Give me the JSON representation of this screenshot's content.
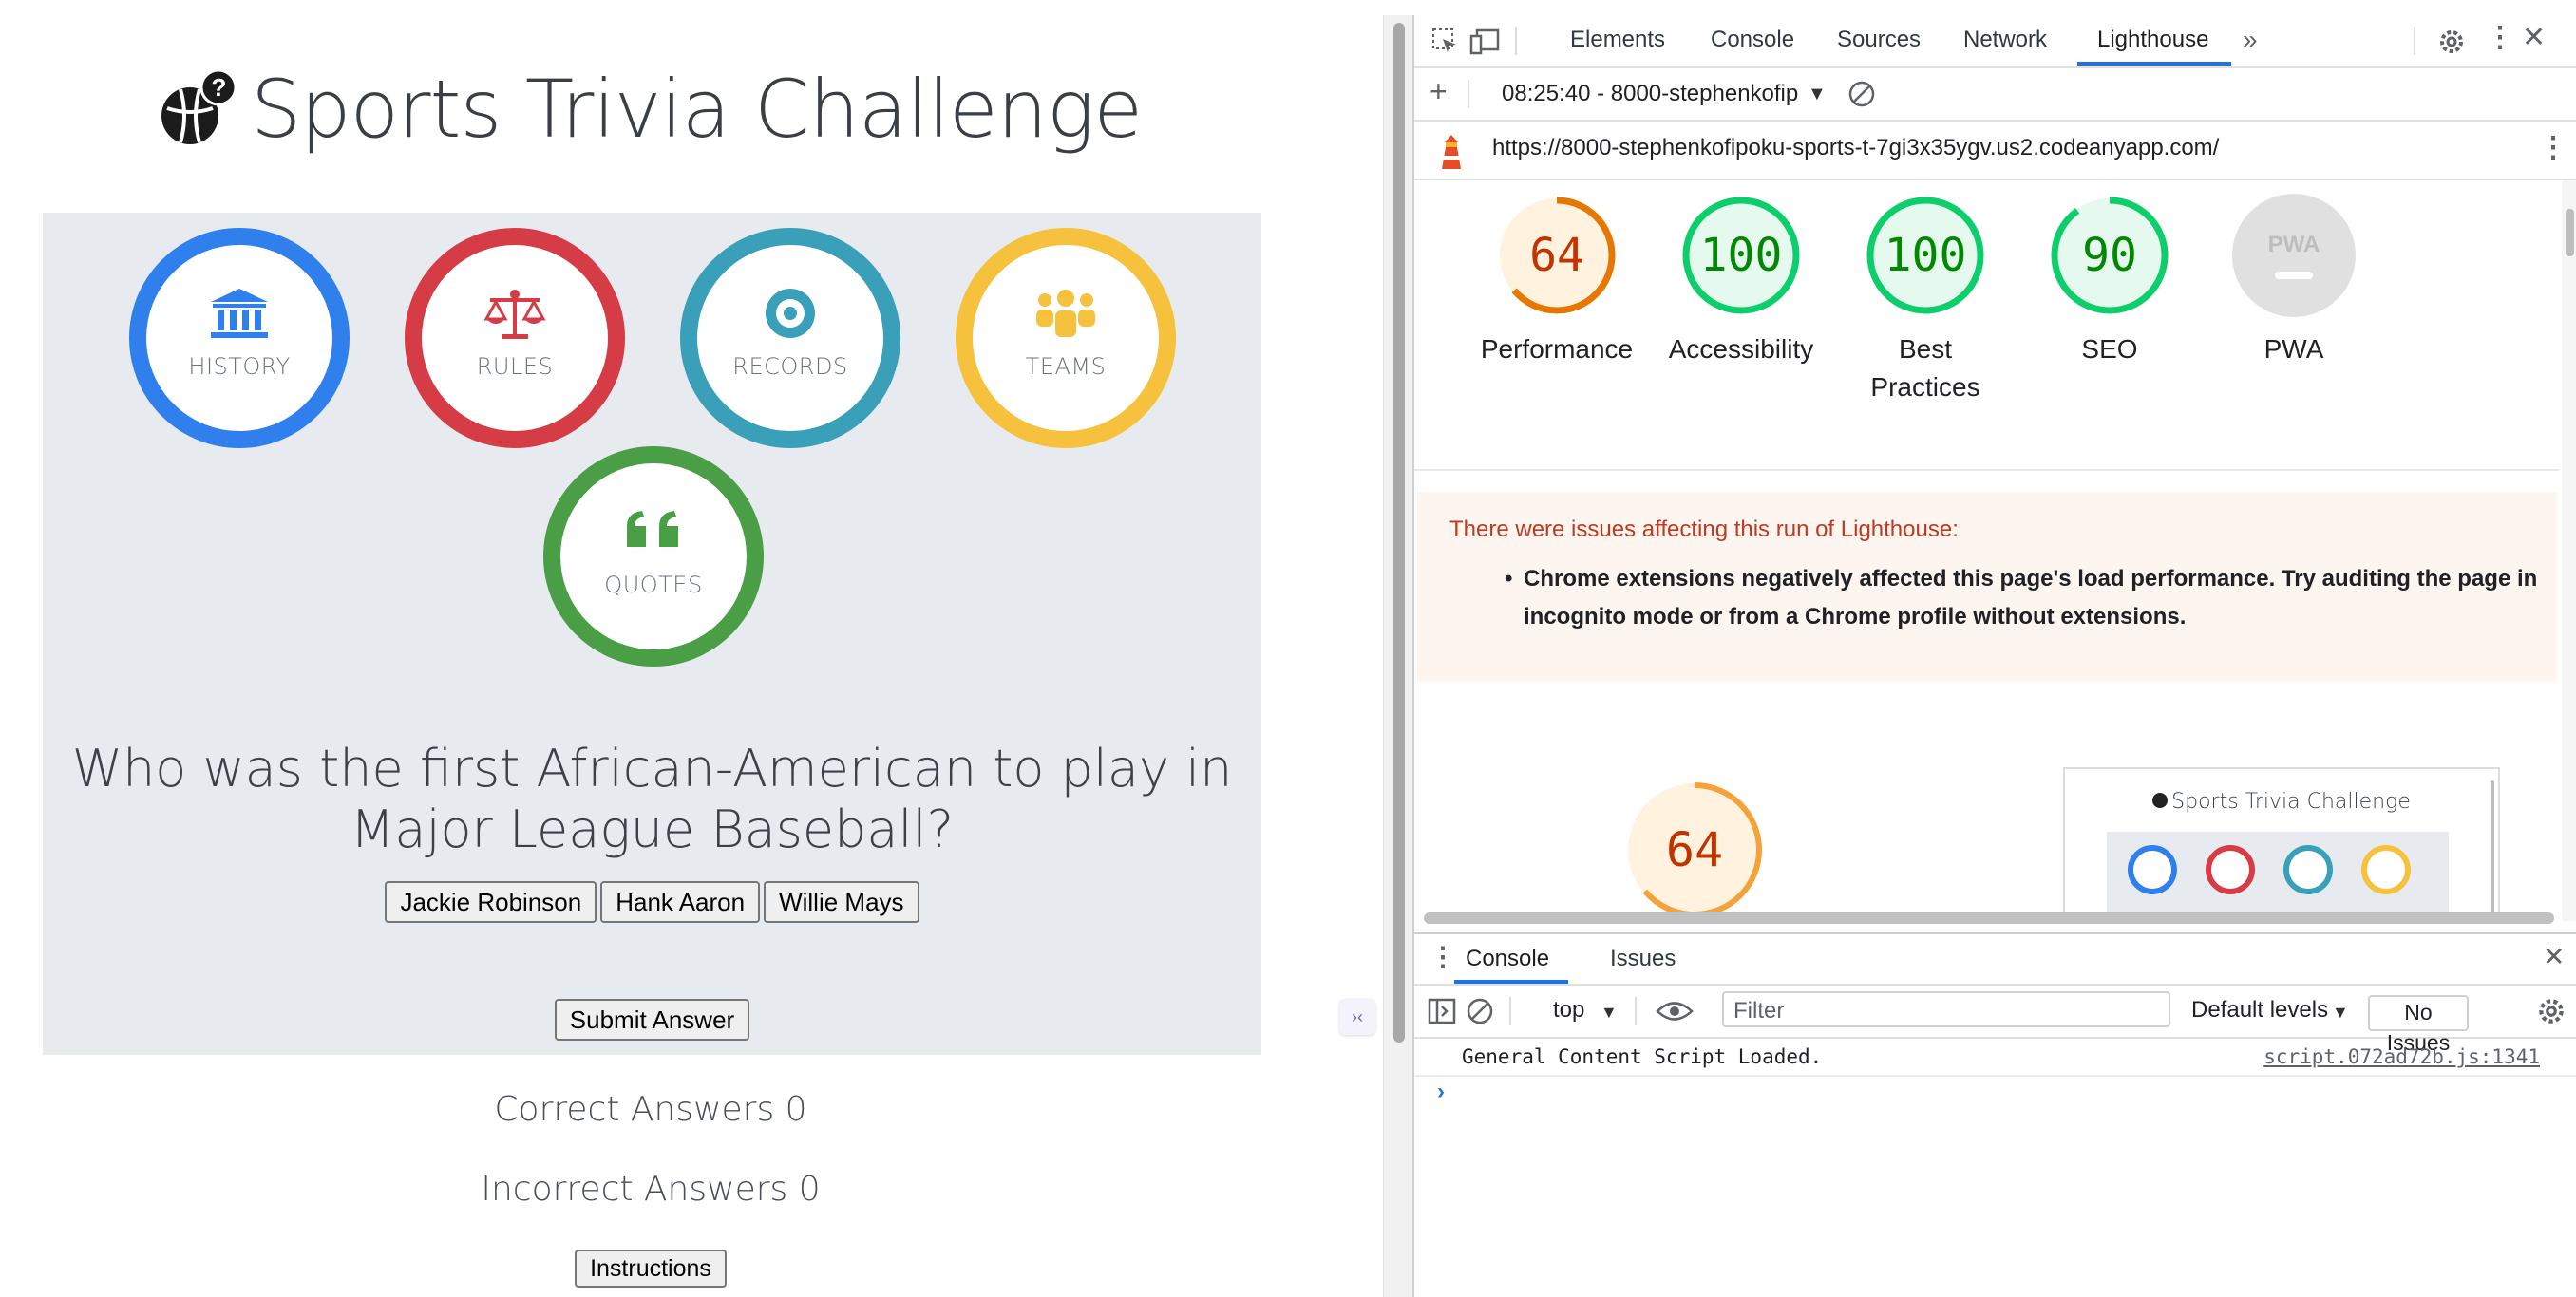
{
  "app": {
    "title": "Sports Trivia Challenge",
    "categories": [
      {
        "label": "HISTORY",
        "icon": "landmark-icon",
        "color": "#2f80ed"
      },
      {
        "label": "RULES",
        "icon": "scale-icon",
        "color": "#d63c45"
      },
      {
        "label": "RECORDS",
        "icon": "target-icon",
        "color": "#3a9fb8"
      },
      {
        "label": "TEAMS",
        "icon": "people-icon",
        "color": "#f6c23e"
      },
      {
        "label": "QUOTES",
        "icon": "quote-icon",
        "color": "#4a9f46"
      }
    ],
    "question": "Who was the first African-American to play in Major League Baseball?",
    "answers": [
      "Jackie Robinson",
      "Hank Aaron",
      "Willie Mays"
    ],
    "submit_label": "Submit Answer",
    "correct_label": "Correct Answers 0",
    "incorrect_label": "Incorrect Answers 0",
    "instructions_label": "Instructions"
  },
  "devtools": {
    "tabs": [
      "Elements",
      "Console",
      "Sources",
      "Network",
      "Lighthouse"
    ],
    "active_tab": "Lighthouse",
    "report_selector": "08:25:40 - 8000-stephenkofip",
    "url": "https://8000-stephenkofipoku-sports-t-7gi3x35ygv.us2.codeanyapp.com/",
    "scores": [
      {
        "label": "Performance",
        "value": "64",
        "score": 64,
        "color": "#e67700",
        "fill": "#fff3e0",
        "text_color": "#c33300"
      },
      {
        "label": "Accessibility",
        "value": "100",
        "score": 100,
        "color": "#0cce6b",
        "fill": "#e6f9ee",
        "text_color": "#008800"
      },
      {
        "label": "Best Practices",
        "value": "100",
        "score": 100,
        "color": "#0cce6b",
        "fill": "#e6f9ee",
        "text_color": "#008800"
      },
      {
        "label": "SEO",
        "value": "90",
        "score": 90,
        "color": "#0cce6b",
        "fill": "#e6f9ee",
        "text_color": "#008800"
      },
      {
        "label": "PWA",
        "value": "PWA",
        "score": null,
        "color": "#e0e0e0",
        "fill": "#e0e0e0",
        "text_color": "#bdbdbd"
      }
    ],
    "warning_title": "There were issues affecting this run of Lighthouse:",
    "warning_text": "Chrome extensions negatively affected this page's load performance. Try auditing the page in incognito mode or from a Chrome profile without extensions.",
    "big_score": "64",
    "thumbnail_title": "Sports Trivia Challenge",
    "drawer_tabs": [
      "Console",
      "Issues"
    ],
    "context": "top",
    "filter_placeholder": "Filter",
    "levels": "Default levels",
    "issues": "No Issues",
    "log_message": "General Content Script Loaded.",
    "log_source": "script.072ad72b.js:1341"
  }
}
